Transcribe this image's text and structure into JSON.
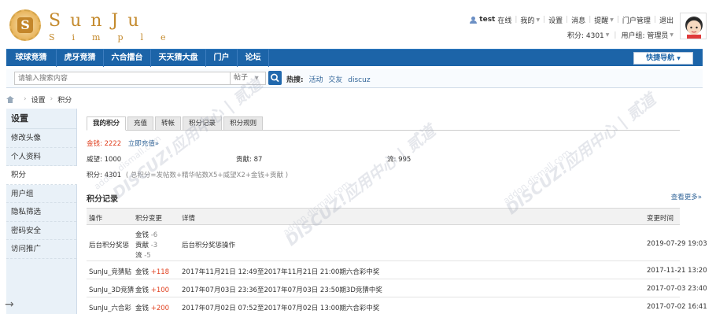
{
  "logo": {
    "title": "SunJu",
    "subtitle": "Simple",
    "mark": "S"
  },
  "user": {
    "name": "test",
    "status": "在线",
    "links": [
      "我的",
      "设置",
      "消息",
      "提醒",
      "门户管理",
      "退出"
    ],
    "points_label": "积分: 4301",
    "group_label": "用户组: 管理员"
  },
  "nav": {
    "items": [
      "球球竞猜",
      "虎牙竞猜",
      "六合擂台",
      "天天猜大盘",
      "门户",
      "论坛"
    ],
    "quick_nav": "快捷导航"
  },
  "search": {
    "placeholder": "请输入搜索内容",
    "type": "帖子",
    "hot_label": "热搜:",
    "hot_terms": [
      "活动",
      "交友",
      "discuz"
    ]
  },
  "breadcrumb": [
    "设置",
    "积分"
  ],
  "sidebar": {
    "title": "设置",
    "items": [
      "修改头像",
      "个人资料",
      "积分",
      "用户组",
      "隐私筛选",
      "密码安全",
      "访问推广"
    ],
    "active_index": 2
  },
  "tabs": [
    "我的积分",
    "充值",
    "转帐",
    "积分记录",
    "积分规则"
  ],
  "points": {
    "gold_label": "金钱: 2222",
    "recharge": "立即充值»",
    "prestige": "威望: 1000",
    "contribution": "贡献: 87",
    "flow": "流: 995",
    "total": "积分: 4301",
    "formula": "( 总积分=发帖数+精华帖数X5+威望X2+金钱+贡献 )"
  },
  "records": {
    "title": "积分记录",
    "see_more": "查看更多»",
    "headers": [
      "操作",
      "积分变更",
      "详情",
      "变更时间"
    ],
    "rows": [
      {
        "op": "后台积分奖惩",
        "changes": [
          {
            "name": "金钱",
            "val": "-6"
          },
          {
            "name": "贡献",
            "val": "-3"
          },
          {
            "name": "流",
            "val": "-5"
          }
        ],
        "detail": "后台积分奖惩操作",
        "time": "2019-07-29 19:03"
      },
      {
        "op": "SunJu_竞猜贴",
        "changes": [
          {
            "name": "金钱",
            "val": "+118"
          }
        ],
        "detail": "2017年11月21日 12:49至2017年11月21日 21:00期六合彩中奖",
        "time": "2017-11-21 13:20"
      },
      {
        "op": "SunJu_3D竞猜",
        "changes": [
          {
            "name": "金钱",
            "val": "+100"
          }
        ],
        "detail": "2017年07月03日 23:36至2017年07月03日 23:50期3D竞猜中奖",
        "time": "2017-07-03 23:40"
      },
      {
        "op": "SunJu_六合彩",
        "changes": [
          {
            "name": "金钱",
            "val": "+200"
          }
        ],
        "detail": "2017年07月02日 07:52至2017年07月02日 13:00期六合彩中奖",
        "time": "2017-07-02 16:41"
      }
    ]
  },
  "watermark": {
    "main": "DISCUZ!应用中心 | 贰道",
    "sub": "addon.dismall.com"
  },
  "colors": {
    "nav_bg": "#1c64a8",
    "accent_red": "#e0401f",
    "link_blue": "#336699",
    "logo_gold": "#c48a2d"
  }
}
